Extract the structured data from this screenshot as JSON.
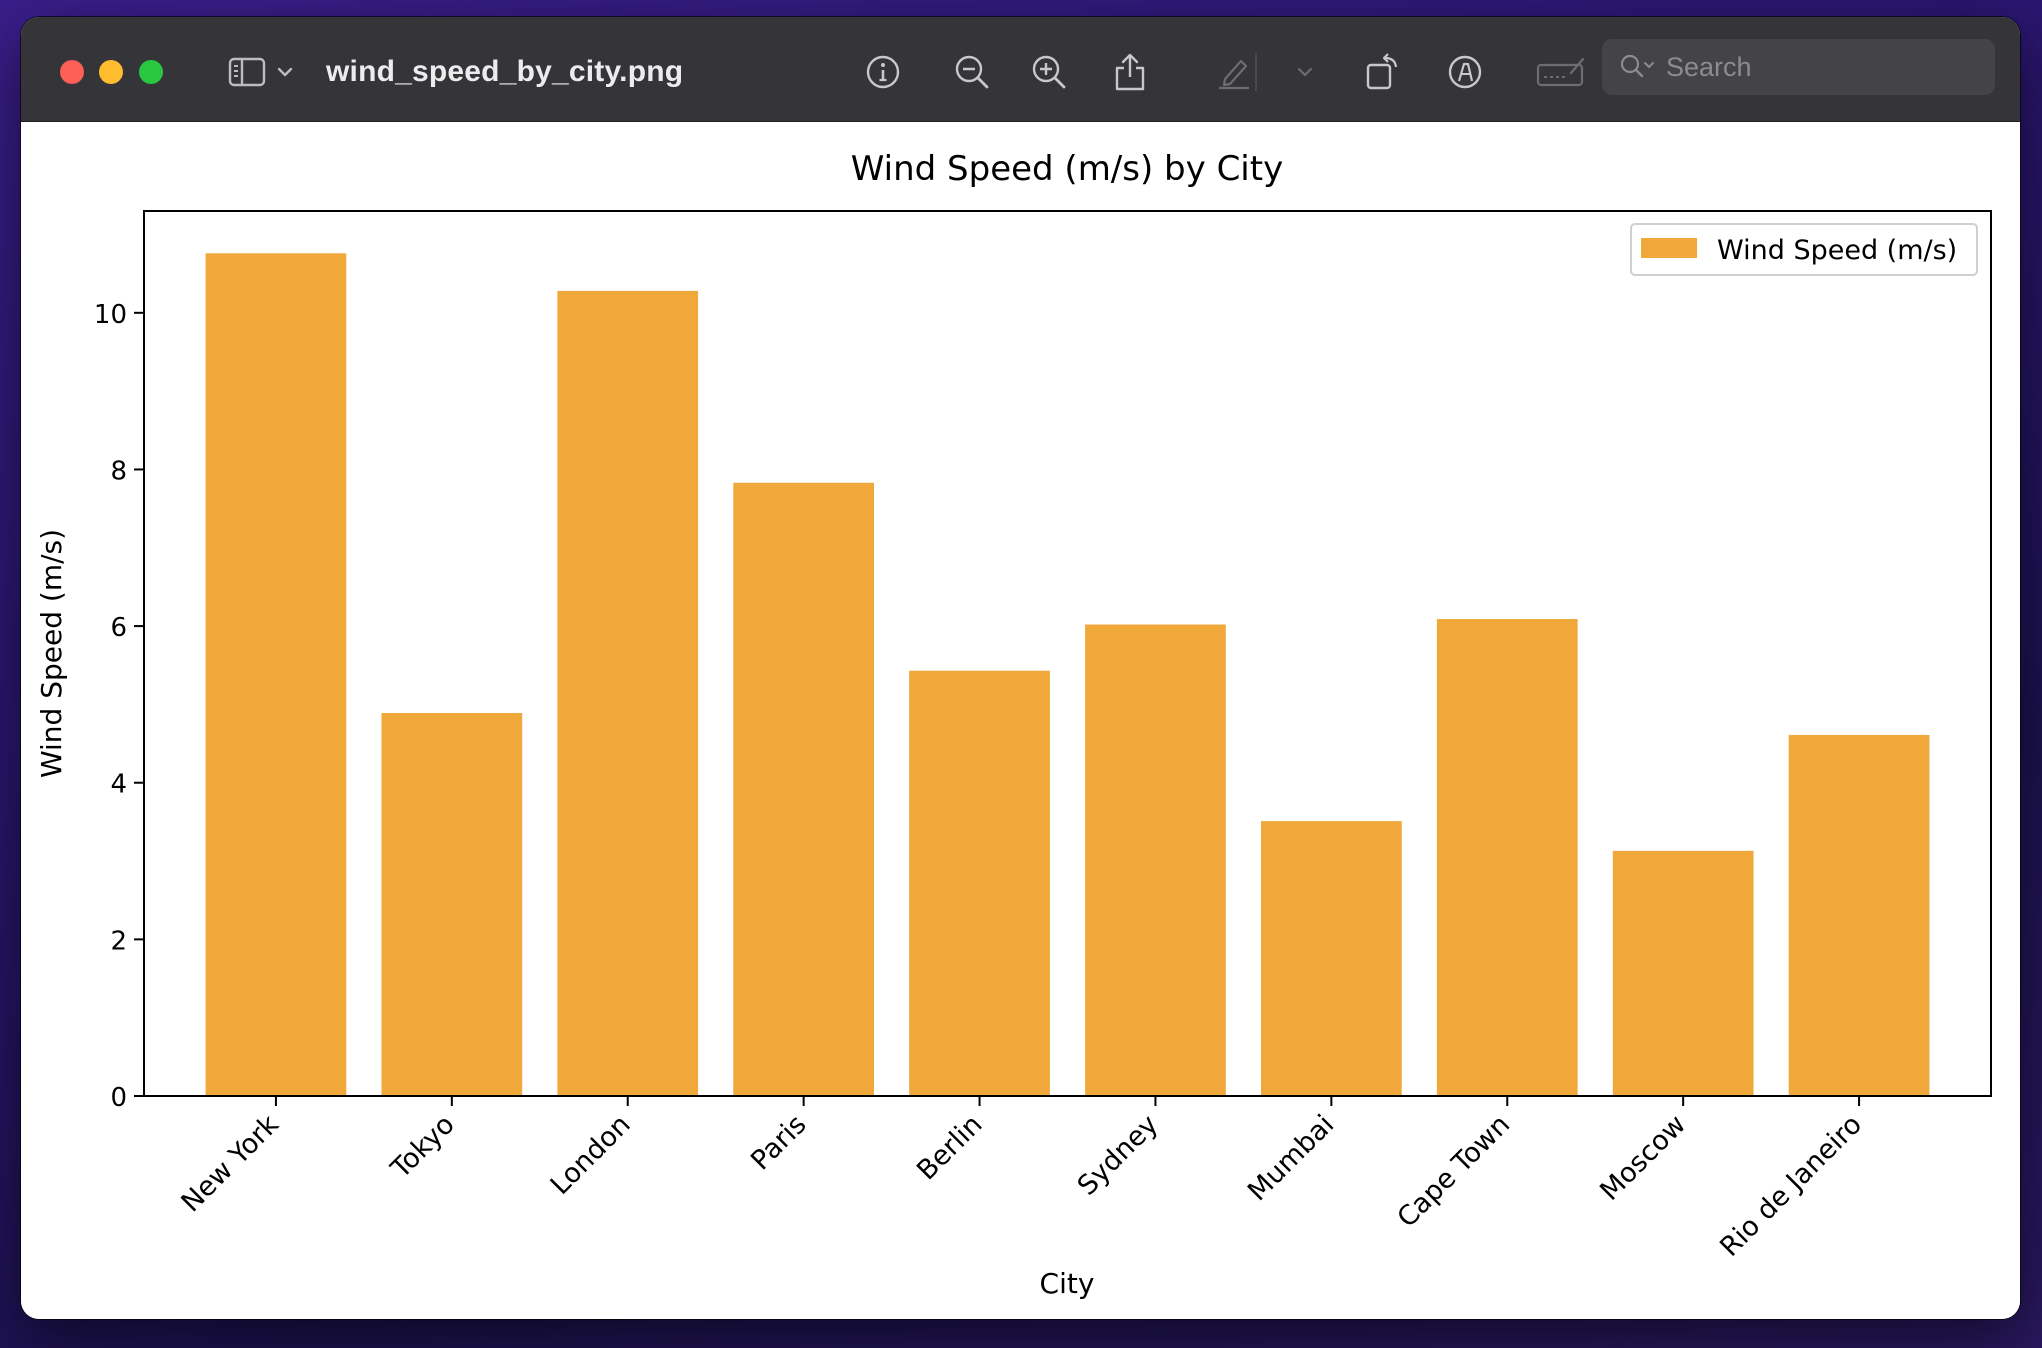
{
  "window": {
    "title": "wind_speed_by_city.png"
  },
  "toolbar": {
    "icons": [
      "sidebar-icon",
      "chevron-down-icon",
      "info-icon",
      "zoom-out-icon",
      "zoom-in-icon",
      "share-icon",
      "highlight-pen-icon",
      "chevron-down-icon",
      "rotate-icon",
      "markup-icon",
      "signature-icon",
      "search-icon"
    ],
    "search_placeholder": "Search"
  },
  "colors": {
    "bar": "#f0a83a",
    "titlebar": "#353438"
  },
  "chart_data": {
    "type": "bar",
    "title": "Wind Speed (m/s) by City",
    "xlabel": "City",
    "ylabel": "Wind Speed (m/s)",
    "categories": [
      "New York",
      "Tokyo",
      "London",
      "Paris",
      "Berlin",
      "Sydney",
      "Mumbai",
      "Cape Town",
      "Moscow",
      "Rio de Janeiro"
    ],
    "series": [
      {
        "name": "Wind Speed (m/s)",
        "values": [
          10.76,
          4.89,
          10.28,
          7.83,
          5.43,
          6.02,
          3.51,
          6.09,
          3.13,
          4.61
        ]
      }
    ],
    "ylim": [
      0,
      11.3
    ],
    "yticks": [
      0,
      2,
      4,
      6,
      8,
      10
    ],
    "grid": false,
    "legend": "top-right",
    "tick_label_rotation": 45
  }
}
